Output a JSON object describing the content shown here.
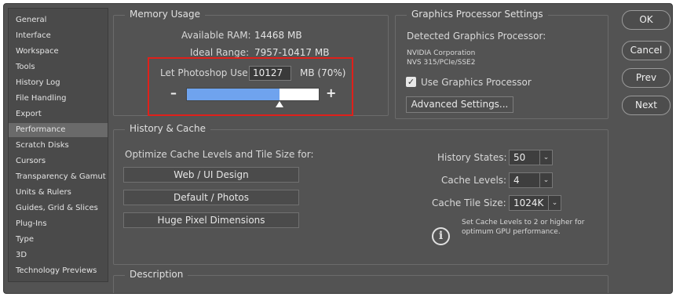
{
  "sidebar": {
    "items": [
      {
        "label": "General"
      },
      {
        "label": "Interface"
      },
      {
        "label": "Workspace"
      },
      {
        "label": "Tools"
      },
      {
        "label": "History Log"
      },
      {
        "label": "File Handling"
      },
      {
        "label": "Export"
      },
      {
        "label": "Performance"
      },
      {
        "label": "Scratch Disks"
      },
      {
        "label": "Cursors"
      },
      {
        "label": "Transparency & Gamut"
      },
      {
        "label": "Units & Rulers"
      },
      {
        "label": "Guides, Grid & Slices"
      },
      {
        "label": "Plug-Ins"
      },
      {
        "label": "Type"
      },
      {
        "label": "3D"
      },
      {
        "label": "Technology Previews"
      }
    ],
    "selected": "Performance"
  },
  "memory": {
    "title": "Memory Usage",
    "available_label": "Available RAM:",
    "available_value": "14468 MB",
    "ideal_label": "Ideal Range:",
    "ideal_value": "7957-10417 MB",
    "let_label": "Let Photoshop Use:",
    "let_value": "10127",
    "let_unit": "MB (70%)",
    "minus": "–",
    "plus": "+",
    "slider_fraction": 0.7
  },
  "gpu": {
    "title": "Graphics Processor Settings",
    "detected_label": "Detected Graphics Processor:",
    "vendor": "NVIDIA Corporation",
    "model": "NVS 315/PCIe/SSE2",
    "use_label": "Use Graphics Processor",
    "use_checked": true,
    "advanced_label": "Advanced Settings..."
  },
  "history": {
    "title": "History & Cache",
    "optimize_label": "Optimize Cache Levels and Tile Size for:",
    "buttons": [
      "Web / UI Design",
      "Default / Photos",
      "Huge Pixel Dimensions"
    ],
    "states_label": "History States:",
    "states_value": "50",
    "levels_label": "Cache Levels:",
    "levels_value": "4",
    "tile_label": "Cache Tile Size:",
    "tile_value": "1024K",
    "note_line1": "Set Cache Levels to 2 or higher for",
    "note_line2": "optimum GPU performance."
  },
  "description": {
    "title": "Description"
  },
  "actions": {
    "ok": "OK",
    "cancel": "Cancel",
    "prev": "Prev",
    "next": "Next"
  },
  "colors": {
    "dialog_bg": "#535353",
    "highlight": "#e0201a",
    "slider_fill": "#6fa3ee"
  }
}
